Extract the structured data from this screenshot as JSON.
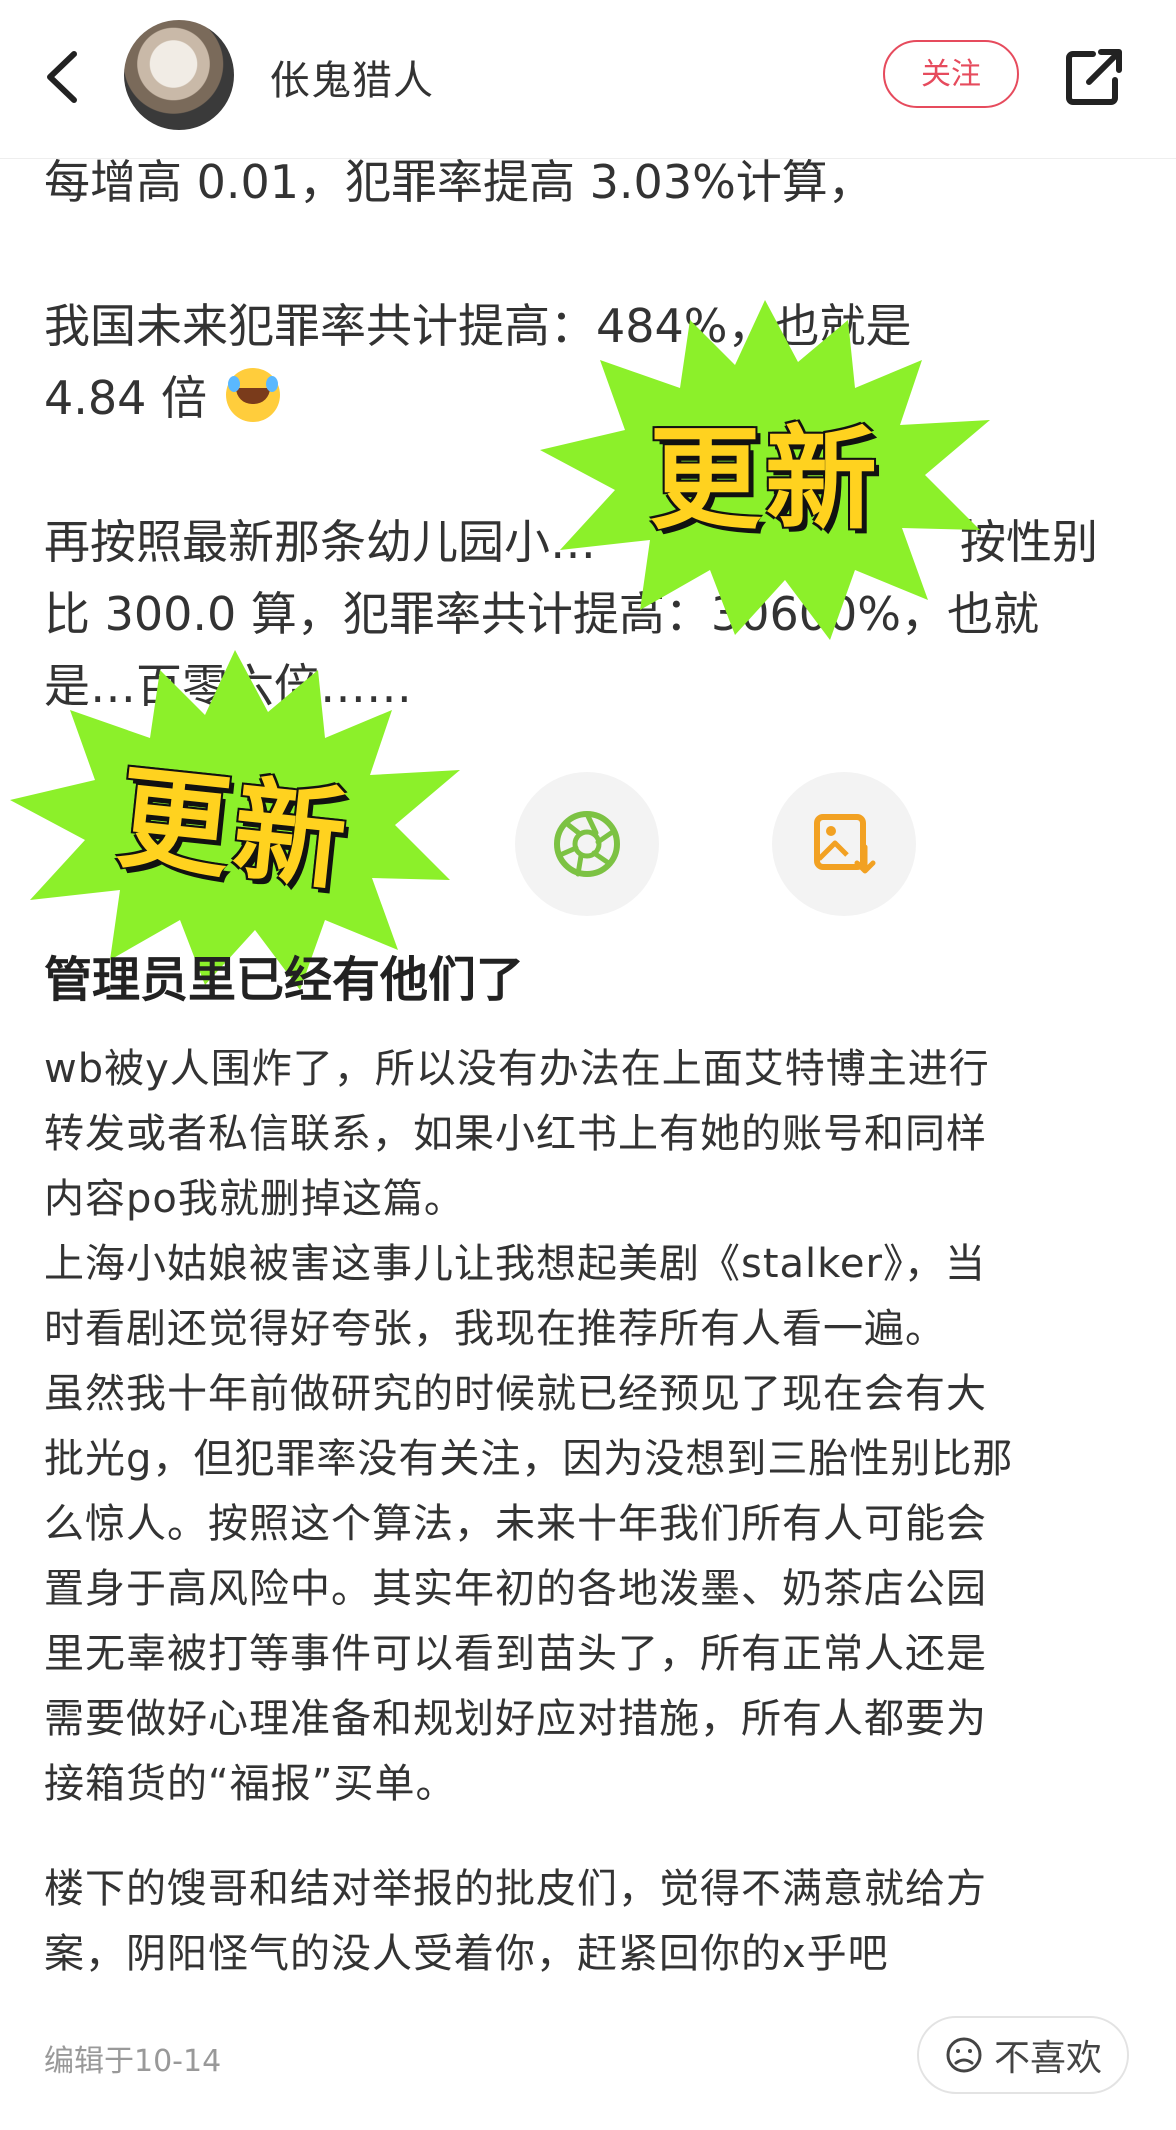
{
  "header": {
    "author_name": "伥鬼猎人",
    "follow_label": "关注"
  },
  "faded_text": {
    "line1": "每增高 0.01，犯罪率提高 3.03%计算，",
    "line2": "我国未来犯罪率共计提高：484%，也就是",
    "line3": "4.84 倍",
    "line4": "再按照最新那条幼儿园小…",
    "line4b": "按性别",
    "line5": "比 300.0 算，犯罪率共计提高：30600%，也就",
    "line6": "是…百零六倍……"
  },
  "stickers": {
    "sticker1": "更新",
    "sticker2": "更新"
  },
  "icons": {
    "emoji": "laughing-tears-emoji",
    "camera": "aperture-icon",
    "save": "image-download-icon",
    "dislike": "frown-face-icon"
  },
  "colors": {
    "follow": "#e64b5d",
    "sticker_burst": "#8cf02a",
    "sticker_text": "#ffd21f",
    "camera_icon": "#7cc243",
    "save_icon": "#f2a122"
  },
  "post": {
    "title": "管理员里已经有他们了",
    "lines": [
      "wb被y人围炸了，所以没有办法在上面艾特博主进行",
      "转发或者私信联系，如果小红书上有她的账号和同样",
      "内容po我就删掉这篇。",
      "上海小姑娘被害这事儿让我想起美剧《stalker》，当",
      "时看剧还觉得好夸张，我现在推荐所有人看一遍。",
      "虽然我十年前做研究的时候就已经预见了现在会有大",
      "批光g，但犯罪率没有关注，因为没想到三胎性别比那",
      "么惊人。按照这个算法，未来十年我们所有人可能会",
      "置身于高风险中。其实年初的各地泼墨、奶茶店公园",
      "里无辜被打等事件可以看到苗头了，所有正常人还是",
      "需要做好心理准备和规划好应对措施，所有人都要为",
      "接箱货的“福报”买单。",
      "楼下的馊哥和结对举报的批皮们，觉得不满意就给方",
      "案，阴阳怪气的没人受着你，赶紧回你的x乎吧"
    ],
    "edit_time": "编辑于10-14"
  },
  "footer": {
    "dislike_label": "不喜欢"
  }
}
